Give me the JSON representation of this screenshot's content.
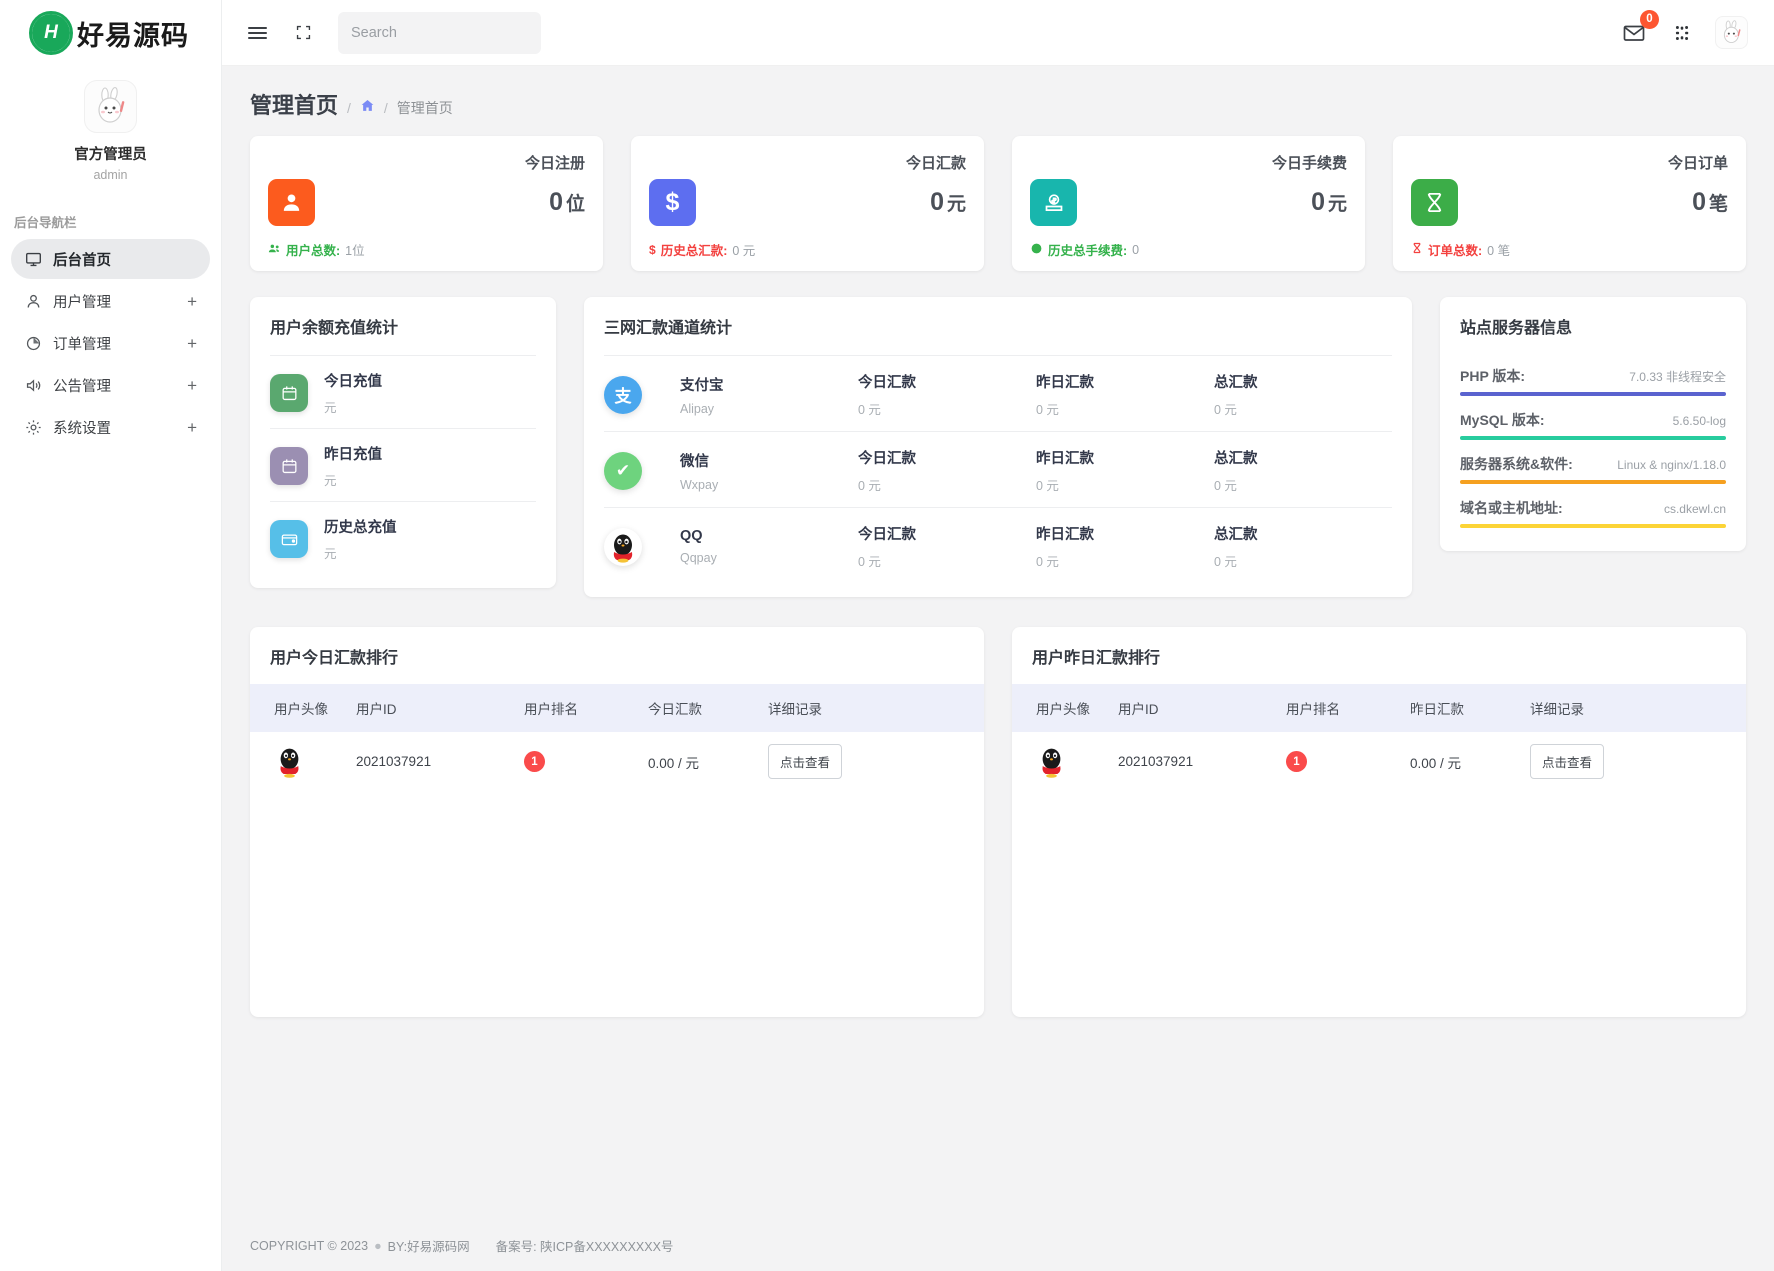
{
  "brand": {
    "logo_letter": "H",
    "name": "好易源码"
  },
  "profile": {
    "name": "官方管理员",
    "role": "admin",
    "avatar_icon": "rabbit-avatar"
  },
  "sidebar": {
    "nav_title": "后台导航栏",
    "items": [
      {
        "label": "后台首页",
        "icon": "monitor-icon",
        "expandable": false,
        "active": true
      },
      {
        "label": "用户管理",
        "icon": "user-icon",
        "expandable": true,
        "plus": "+",
        "active": false
      },
      {
        "label": "订单管理",
        "icon": "pie-chart-icon",
        "expandable": true,
        "plus": "+",
        "active": false
      },
      {
        "label": "公告管理",
        "icon": "megaphone-icon",
        "expandable": true,
        "plus": "+",
        "active": false
      },
      {
        "label": "系统设置",
        "icon": "gear-icon",
        "expandable": true,
        "plus": "+",
        "active": false
      }
    ]
  },
  "topbar": {
    "menu_icon": "hamburger-icon",
    "fullscreen_icon": "fullscreen-icon",
    "search": {
      "value": "",
      "placeholder": "Search",
      "icon": "search-icon"
    },
    "mail_icon": "mail-icon",
    "mail_badge": "0",
    "apps_icon": "apps-grid-icon",
    "avatar_icon": "rabbit-avatar"
  },
  "page": {
    "title": "管理首页",
    "breadcrumb": {
      "sep1": "/",
      "home_icon": "home-icon",
      "sep2": "/",
      "current": "管理首页"
    }
  },
  "stats": [
    {
      "label": "今日注册",
      "value": "0",
      "unit": "位",
      "icon": "user-solid-icon",
      "color": "#fc5b1e",
      "foot_icon": "users-icon",
      "foot_key": "用户总数:",
      "foot_key_color": "#35b24c",
      "foot_value": "1位"
    },
    {
      "label": "今日汇款",
      "value": "0",
      "unit": "元",
      "icon": "dollar-icon",
      "color": "#5d6ef0",
      "foot_icon": "dollar-sign-icon",
      "foot_key": "历史总汇款:",
      "foot_key_color": "#f3413f",
      "foot_value": "0 元"
    },
    {
      "label": "今日手续费",
      "value": "0",
      "unit": "元",
      "icon": "coin-deposit-icon",
      "color": "#18b6ad",
      "foot_icon": "coin-icon",
      "foot_key": "历史总手续费:",
      "foot_key_color": "#35b24c",
      "foot_value": "0"
    },
    {
      "label": "今日订单",
      "value": "0",
      "unit": "笔",
      "icon": "dna-icon",
      "color": "#3cad48",
      "foot_icon": "dna-small-icon",
      "foot_key": "订单总数:",
      "foot_key_color": "#f3413f",
      "foot_value": "0 笔"
    }
  ],
  "recharge_card": {
    "title": "用户余额充值统计",
    "rows": [
      {
        "title": "今日充值",
        "sub": "元",
        "icon": "calendar-today-icon",
        "color": "#5aa86f"
      },
      {
        "title": "昨日充值",
        "sub": "元",
        "icon": "calendar-yesterday-icon",
        "color": "#9b8fb2"
      },
      {
        "title": "历史总充值",
        "sub": "元",
        "icon": "wallet-icon",
        "color": "#56bfe8"
      }
    ]
  },
  "channel_card": {
    "title": "三网汇款通道统计",
    "rows": [
      {
        "icon": "alipay-icon",
        "color": "#4aa7ee",
        "glyph": "支",
        "name": "支付宝",
        "code": "Alipay",
        "c1_label": "今日汇款",
        "c1_value": "0 元",
        "c2_label": "昨日汇款",
        "c2_value": "0 元",
        "c3_label": "总汇款",
        "c3_value": "0 元"
      },
      {
        "icon": "wechat-pay-icon",
        "color": "#6ed37e",
        "glyph": "✔",
        "name": "微信",
        "code": "Wxpay",
        "c1_label": "今日汇款",
        "c1_value": "0 元",
        "c2_label": "昨日汇款",
        "c2_value": "0 元",
        "c3_label": "总汇款",
        "c3_value": "0 元"
      },
      {
        "icon": "qq-pay-icon",
        "color": "#ffffff",
        "glyph": "",
        "name": "QQ",
        "code": "Qqpay",
        "c1_label": "今日汇款",
        "c1_value": "0 元",
        "c2_label": "昨日汇款",
        "c2_value": "0 元",
        "c3_label": "总汇款",
        "c3_value": "0 元"
      }
    ]
  },
  "server_card": {
    "title": "站点服务器信息",
    "rows": [
      {
        "key": "PHP 版本:",
        "value": "7.0.33 非线程安全",
        "bar_color": "#5a63cf",
        "bar_pct": 100
      },
      {
        "key": "MySQL 版本:",
        "value": "5.6.50-log",
        "bar_color": "#28cc9e",
        "bar_pct": 100
      },
      {
        "key": "服务器系统&软件:",
        "value": "Linux & nginx/1.18.0",
        "bar_color": "#f5a020",
        "bar_pct": 100
      },
      {
        "key": "域名或主机地址:",
        "value": "cs.dkewl.cn",
        "bar_color": "#fcd436",
        "bar_pct": 100
      }
    ]
  },
  "rank_today": {
    "title": "用户今日汇款排行",
    "columns": [
      "用户头像",
      "用户ID",
      "用户排名",
      "今日汇款",
      "详细记录"
    ],
    "rows": [
      {
        "avatar": "qq-penguin-icon",
        "user_id": "2021037921",
        "rank": "1",
        "amount": "0.00 / 元",
        "action": "点击查看"
      }
    ]
  },
  "rank_yesterday": {
    "title": "用户昨日汇款排行",
    "columns": [
      "用户头像",
      "用户ID",
      "用户排名",
      "昨日汇款",
      "详细记录"
    ],
    "rows": [
      {
        "avatar": "qq-penguin-icon",
        "user_id": "2021037921",
        "rank": "1",
        "amount": "0.00 / 元",
        "action": "点击查看"
      }
    ]
  },
  "footer": {
    "copyright": "COPYRIGHT © 2023",
    "dot": "●",
    "by": "BY:好易源码网",
    "icp": "备案号: 陕ICP备XXXXXXXXX号"
  }
}
